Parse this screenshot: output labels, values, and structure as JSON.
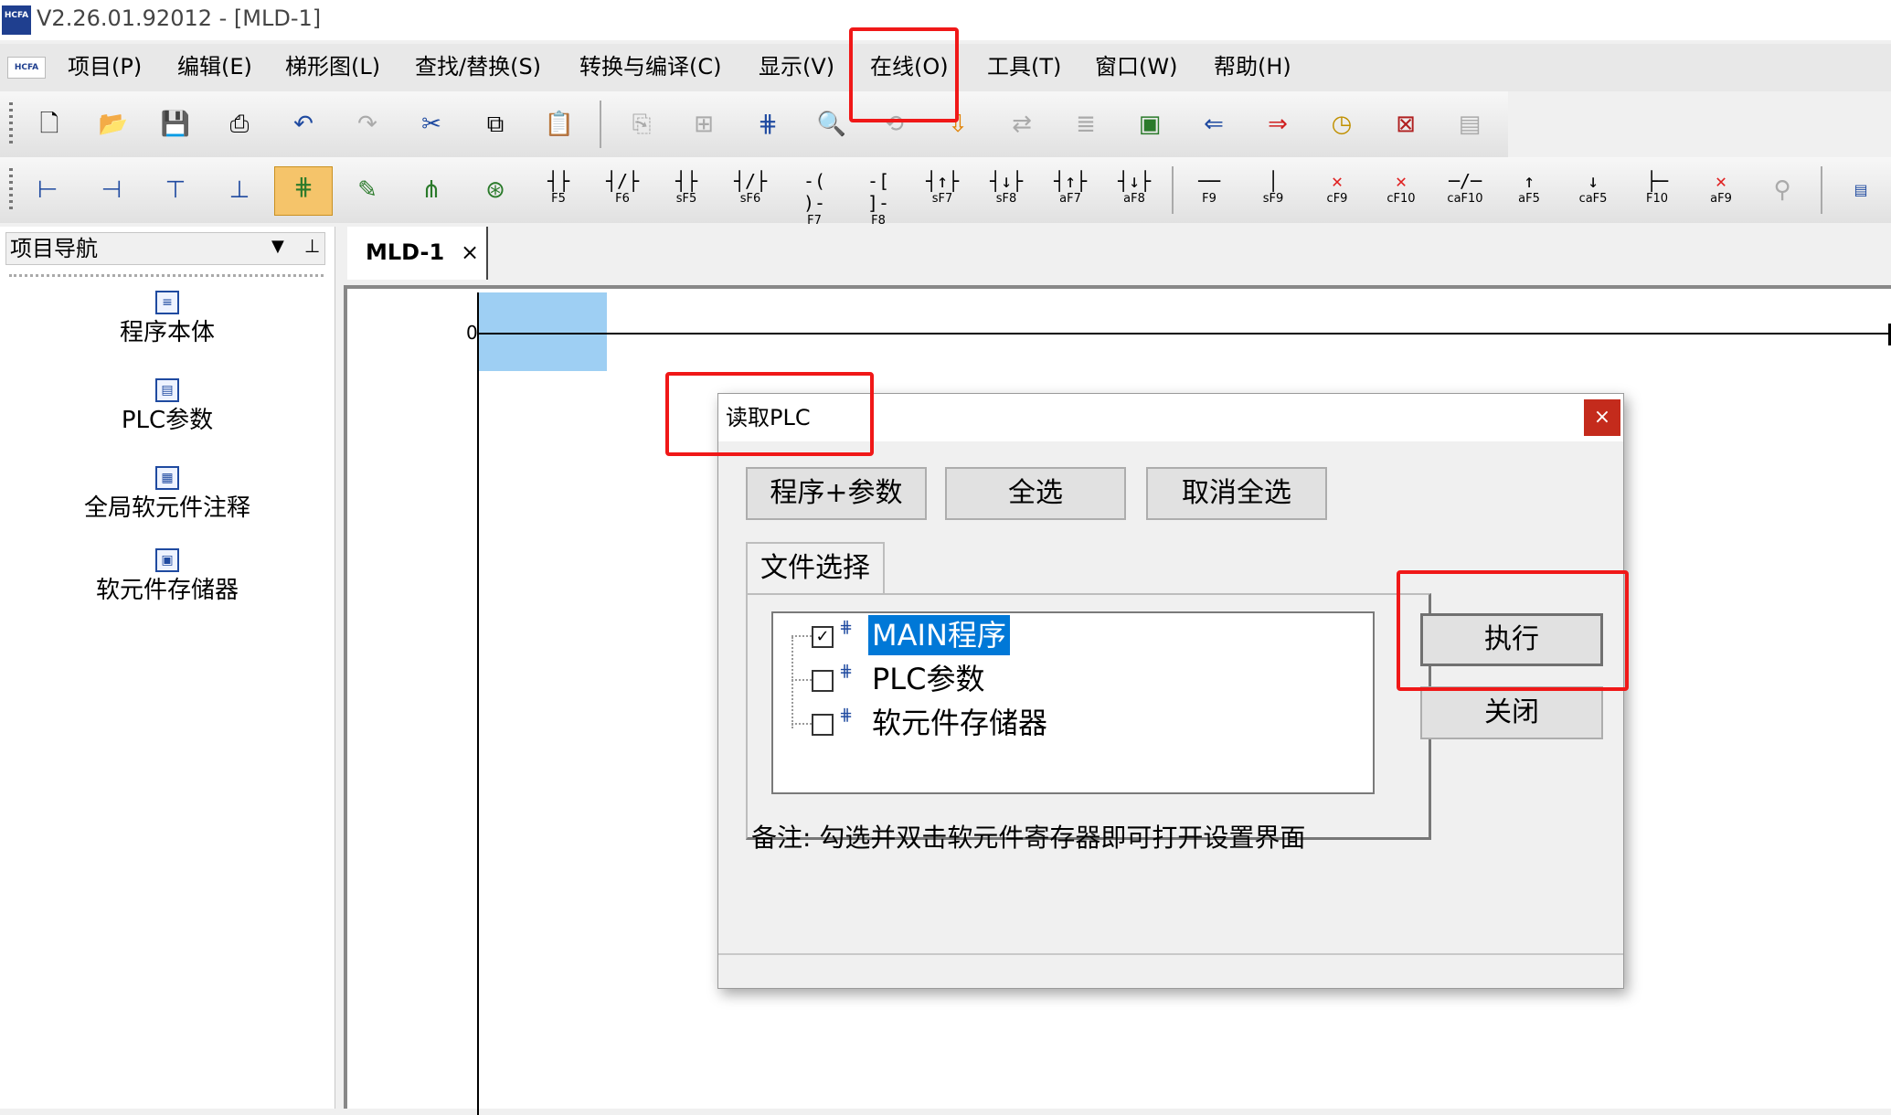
{
  "window": {
    "title": "V2.26.01.92012 - [MLD-1]",
    "logo": "HCFA"
  },
  "menu": {
    "logo": "HCFA",
    "items": [
      "项目(P)",
      "编辑(E)",
      "梯形图(L)",
      "查找/替换(S)",
      "转换与编译(C)",
      "显示(V)",
      "在线(O)",
      "工具(T)",
      "窗口(W)",
      "帮助(H)"
    ]
  },
  "toolbar1": {
    "icons": [
      "new-file-icon",
      "open-folder-icon",
      "save-icon",
      "print-icon",
      "undo-icon",
      "redo-icon",
      "cut-icon",
      "copy-icon",
      "paste-icon",
      "paste-special-icon",
      "grid-icon",
      "ladder-network-icon",
      "zoom-icon",
      "find-replace-icon",
      "download-icon",
      "transfer-icon",
      "compare-icon",
      "monitor-icon",
      "read-plc-icon",
      "write-plc-icon",
      "clock-icon",
      "diagnose-icon",
      "memory-icon"
    ]
  },
  "toolbar2": {
    "mode_icons": [
      "insert-row-icon",
      "delete-row-icon",
      "insert-column-icon",
      "delete-column-icon",
      "ladder-edit-icon",
      "ladder-write-icon",
      "ladder-read-icon",
      "ladder-monitor-icon"
    ],
    "fkeys": [
      {
        "sym": "┤├",
        "label": "F5"
      },
      {
        "sym": "┤/├",
        "label": "F6"
      },
      {
        "sym": "┤├",
        "label": "sF5"
      },
      {
        "sym": "┤/├",
        "label": "sF6"
      },
      {
        "sym": "-( )-",
        "label": "F7"
      },
      {
        "sym": "-[ ]-",
        "label": "F8"
      },
      {
        "sym": "┤↑├",
        "label": "sF7"
      },
      {
        "sym": "┤↓├",
        "label": "sF8"
      },
      {
        "sym": "┤↑├",
        "label": "aF7"
      },
      {
        "sym": "┤↓├",
        "label": "aF8"
      },
      {
        "sym": "──",
        "label": "F9"
      },
      {
        "sym": "│",
        "label": "sF9"
      },
      {
        "sym": "✕",
        "label": "cF9"
      },
      {
        "sym": "✕",
        "label": "cF10"
      },
      {
        "sym": "─/─",
        "label": "caF10"
      },
      {
        "sym": "↑",
        "label": "aF5"
      },
      {
        "sym": "↓",
        "label": "caF5"
      },
      {
        "sym": "├─",
        "label": "F10"
      },
      {
        "sym": "✕",
        "label": "aF9"
      }
    ]
  },
  "nav": {
    "title": "项目导航",
    "items": [
      "程序本体",
      "PLC参数",
      "全局软元件注释",
      "软元件存储器"
    ]
  },
  "tabs": [
    {
      "label": "MLD-1",
      "close": "×"
    }
  ],
  "ladder": {
    "rung_number": "0"
  },
  "dialog": {
    "title": "读取PLC",
    "close": "×",
    "buttons": {
      "program_params": "程序+参数",
      "select_all": "全选",
      "deselect_all": "取消全选",
      "execute": "执行",
      "close": "关闭"
    },
    "tab_label": "文件选择",
    "tree": [
      {
        "label": "MAIN程序",
        "checked": true,
        "selected": true
      },
      {
        "label": "PLC参数",
        "checked": false,
        "selected": false
      },
      {
        "label": "软元件存储器",
        "checked": false,
        "selected": false
      }
    ],
    "note": "备注: 勾选并双击软元件寄存器即可打开设置界面"
  },
  "colors": {
    "highlight": "#f01818",
    "selection": "#0078d7",
    "cursor": "#9ecff3"
  }
}
